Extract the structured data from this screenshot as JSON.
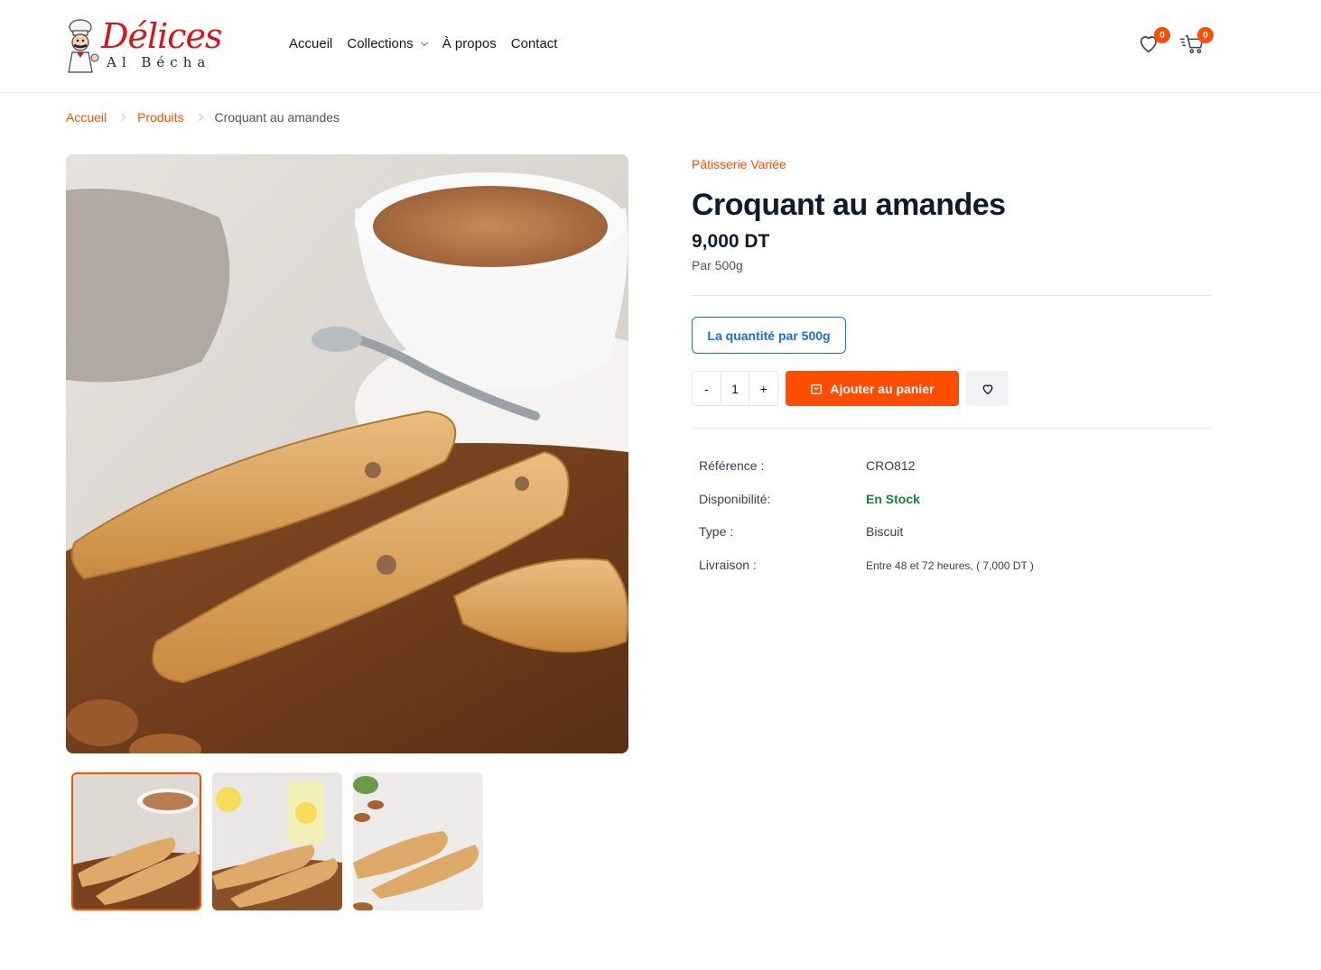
{
  "brand": {
    "name_script": "Délices",
    "name_sub": "Al Bécha",
    "color": "#d7141a"
  },
  "nav": {
    "items": [
      "Accueil",
      "Collections",
      "À propos",
      "Contact"
    ]
  },
  "header_icons": {
    "wishlist_count": "0",
    "cart_count": "0"
  },
  "breadcrumb": {
    "home": "Accueil",
    "products": "Produits",
    "current": "Croquant au amandes"
  },
  "product": {
    "category": "Pâtisserie Variée",
    "title": "Croquant au amandes",
    "price": "9,000 DT",
    "unit": "Par 500g",
    "option_label": "La quantité par 500g",
    "quantity": "1",
    "minus": "-",
    "plus": "+",
    "add_to_cart": "Ajouter au panier",
    "accent_color": "#ff4d00"
  },
  "specs": [
    {
      "label": "Référence :",
      "value": "CRO812"
    },
    {
      "label": "Disponibilité:",
      "value": "En Stock"
    },
    {
      "label": "Type :",
      "value": "Biscuit"
    },
    {
      "label": "Livraison :",
      "value": "Entre 48 et 72 heures, ( 7,000 DT )"
    }
  ]
}
